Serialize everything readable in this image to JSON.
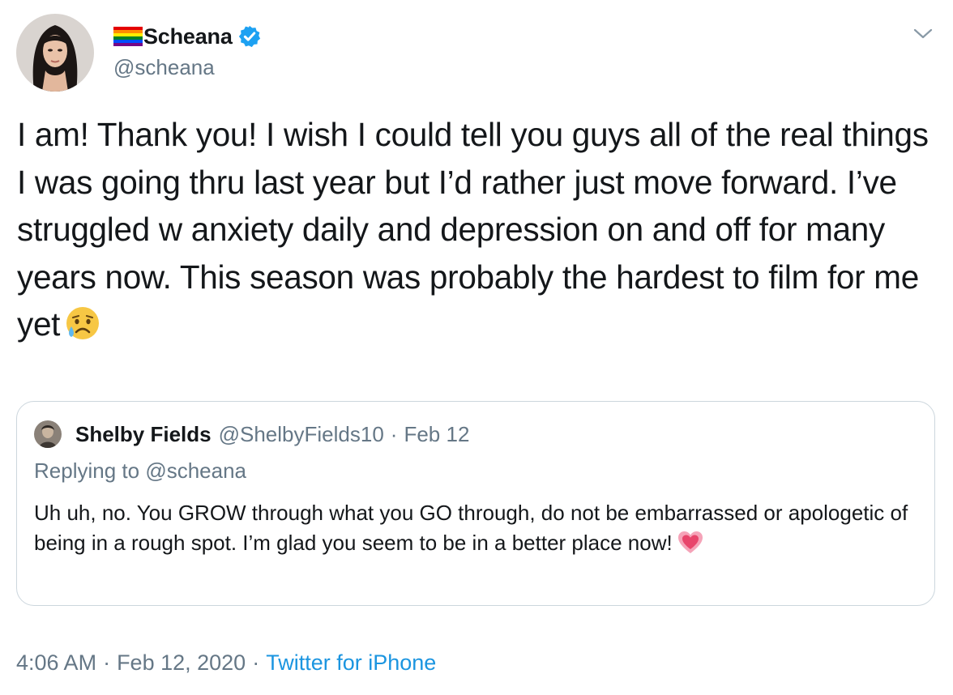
{
  "author": {
    "display_name": "Scheana",
    "handle": "@scheana",
    "flag_icon": "rainbow-flag-icon",
    "verified_icon": "verified-badge-icon",
    "verified_color": "#1da1f2"
  },
  "tweet": {
    "text": "I am! Thank you! I wish I could tell you guys all of the real things I was going thru last year but I’d rather just move forward. I’ve struggled w anxiety daily and depression on and off for many years now. This season was probably the hardest to film for me yet",
    "emoji_icon": "sad-but-relieved-face-emoji-icon"
  },
  "quoted_tweet": {
    "display_name": "Shelby Fields",
    "handle": "@ShelbyFields10",
    "separator": "·",
    "date": "Feb 12",
    "replying_prefix": "Replying to",
    "replying_to": "@scheana",
    "text": "Uh uh, no. You GROW through what you GO through, do not be embarrassed or apologetic of being in a rough spot. I’m glad you seem to be in a better place now!",
    "emoji_icon": "growing-heart-emoji-icon"
  },
  "meta": {
    "time": "4:06 AM",
    "separator": "·",
    "date": "Feb 12, 2020",
    "source": "Twitter for iPhone",
    "source_color": "#1b95e0"
  },
  "colors": {
    "primary_text": "#14171a",
    "secondary_text": "#657786",
    "border": "#ccd6dd"
  }
}
